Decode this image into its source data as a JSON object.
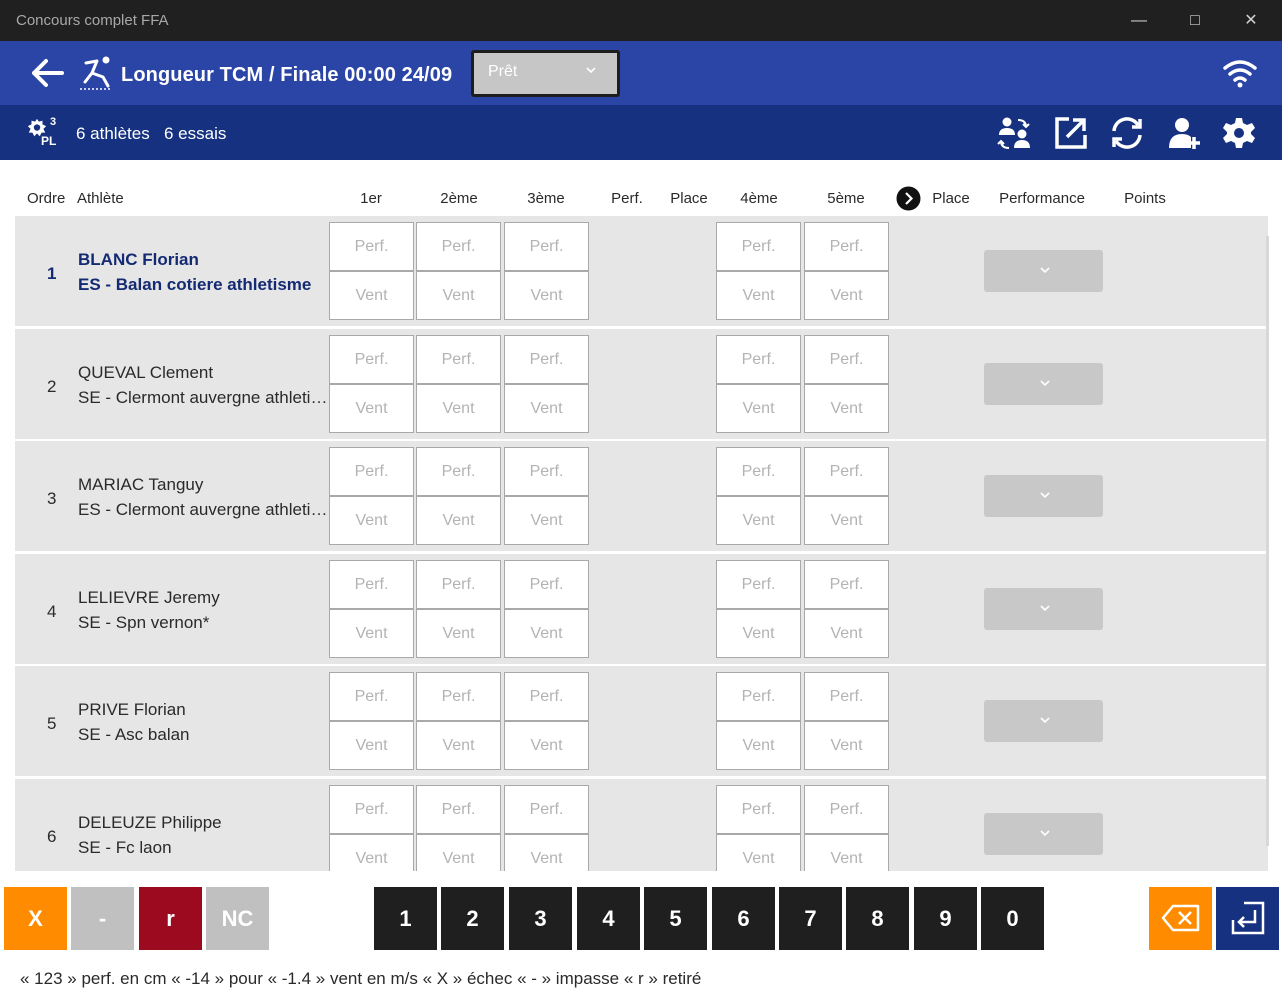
{
  "window": {
    "title": "Concours complet FFA"
  },
  "header": {
    "title": "Longueur TCM / Finale 00:00 24/09",
    "status_selected": "Prêt"
  },
  "subheader": {
    "pl_superscript": "3",
    "pl_label": "PL",
    "athletes": "6 athlètes",
    "attempts": "6 essais"
  },
  "columns": {
    "order": "Ordre",
    "athlete": "Athlète",
    "t1": "1er",
    "t2": "2ème",
    "t3": "3ème",
    "perf": "Perf.",
    "place1": "Place",
    "t4": "4ème",
    "t5": "5ème",
    "place2": "Place",
    "performance": "Performance",
    "points": "Points"
  },
  "placeholders": {
    "perf": "Perf.",
    "wind": "Vent"
  },
  "athletes": [
    {
      "order": "1",
      "name": "BLANC Florian",
      "club": "ES - Balan cotiere athletisme",
      "selected": true
    },
    {
      "order": "2",
      "name": "QUEVAL Clement",
      "club": "SE - Clermont auvergne athletisme",
      "selected": false
    },
    {
      "order": "3",
      "name": "MARIAC Tanguy",
      "club": "ES - Clermont auvergne athletisme",
      "selected": false
    },
    {
      "order": "4",
      "name": "LELIEVRE Jeremy",
      "club": "SE - Spn vernon*",
      "selected": false
    },
    {
      "order": "5",
      "name": "PRIVE Florian",
      "club": "SE - Asc balan",
      "selected": false
    },
    {
      "order": "6",
      "name": "DELEUZE Philippe",
      "club": "SE - Fc laon",
      "selected": false
    }
  ],
  "keypad": {
    "specials": [
      "X",
      "-",
      "r",
      "NC"
    ],
    "digits": [
      "1",
      "2",
      "3",
      "4",
      "5",
      "6",
      "7",
      "8",
      "9",
      "0"
    ]
  },
  "help_text": "« 123 » perf. en cm  « -14 » pour « -1.4 » vent en m/s  « X » échec  « - » impasse  « r » retiré",
  "colors": {
    "appbar": "#2a45a6",
    "subbar": "#15317f",
    "selected_text": "#142a73",
    "key_x": "#ff8c00",
    "key_dash": "#c0c0c0",
    "key_r": "#9b0a1e",
    "key_nc": "#c0c0c0",
    "key_digit": "#1f1f1f",
    "key_backspace": "#ff8c00",
    "key_enter": "#15317f"
  },
  "icons": {
    "back": "arrow-left-icon",
    "event": "long-jump-icon",
    "wifi": "wifi-icon",
    "settings_pl": "gear-pl-icon",
    "tools": [
      "swap-athletes-icon",
      "export-icon",
      "refresh-icon",
      "add-person-icon",
      "settings-gear-icon"
    ],
    "next": "chevron-right-circle-icon",
    "backspace": "backspace-icon",
    "enter": "enter-icon"
  }
}
